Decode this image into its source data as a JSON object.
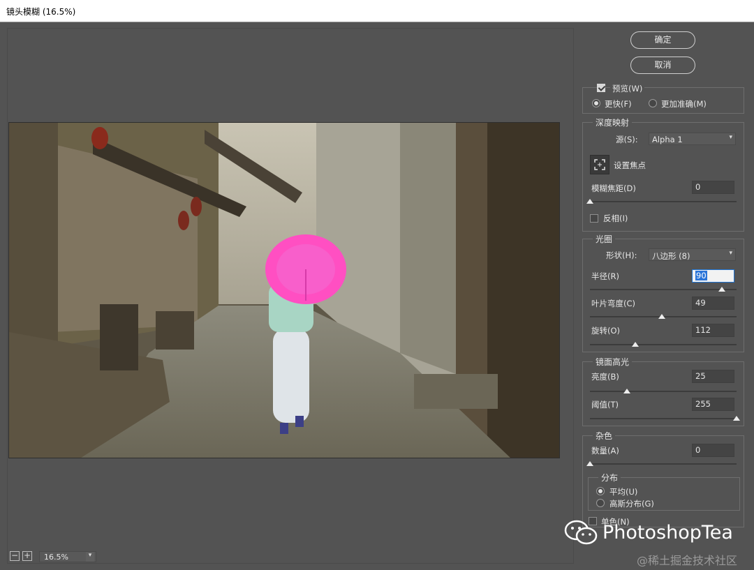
{
  "window": {
    "title": "镜头模糊 (16.5%)"
  },
  "buttons": {
    "ok": "确定",
    "cancel": "取消"
  },
  "preview": {
    "preview_label": "预览(W)",
    "preview_checked": true,
    "faster": "更快(F)",
    "more_accurate": "更加准确(M)",
    "selected": "faster"
  },
  "depth_map": {
    "group_label": "深度映射",
    "source_label": "源(S):",
    "source_value": "Alpha 1",
    "set_focus": "设置焦点",
    "blur_focal_label": "模糊焦距(D)",
    "blur_focal_value": "0",
    "blur_focal_fraction": 0.0,
    "invert_label": "反相(I)",
    "invert_checked": false
  },
  "iris": {
    "group_label": "光圈",
    "shape_label": "形状(H):",
    "shape_value": "八边形 (8)",
    "radius_label": "半径(R)",
    "radius_value": "90",
    "radius_fraction": 0.9,
    "blade_label": "叶片弯度(C)",
    "blade_value": "49",
    "blade_fraction": 0.49,
    "rotation_label": "旋转(O)",
    "rotation_value": "112",
    "rotation_fraction": 0.31
  },
  "specular": {
    "group_label": "镜面高光",
    "brightness_label": "亮度(B)",
    "brightness_value": "25",
    "brightness_fraction": 0.25,
    "threshold_label": "阈值(T)",
    "threshold_value": "255",
    "threshold_fraction": 1.0
  },
  "noise": {
    "group_label": "杂色",
    "amount_label": "数量(A)",
    "amount_value": "0",
    "amount_fraction": 0.0,
    "distribution_label": "分布",
    "uniform": "平均(U)",
    "gaussian": "高斯分布(G)",
    "selected": "uniform",
    "mono_label": "单色(N)",
    "mono_checked": false
  },
  "zoom": {
    "minus": "−",
    "plus": "+",
    "value": "16.5%"
  },
  "watermark": {
    "text": "PhotoshopTea",
    "icon": "wechat-icon"
  },
  "credit": "@稀土掘金技术社区",
  "colors": {
    "umbrella": "#ff4fc2",
    "panel": "#535353",
    "accent": "#2a74d8"
  }
}
